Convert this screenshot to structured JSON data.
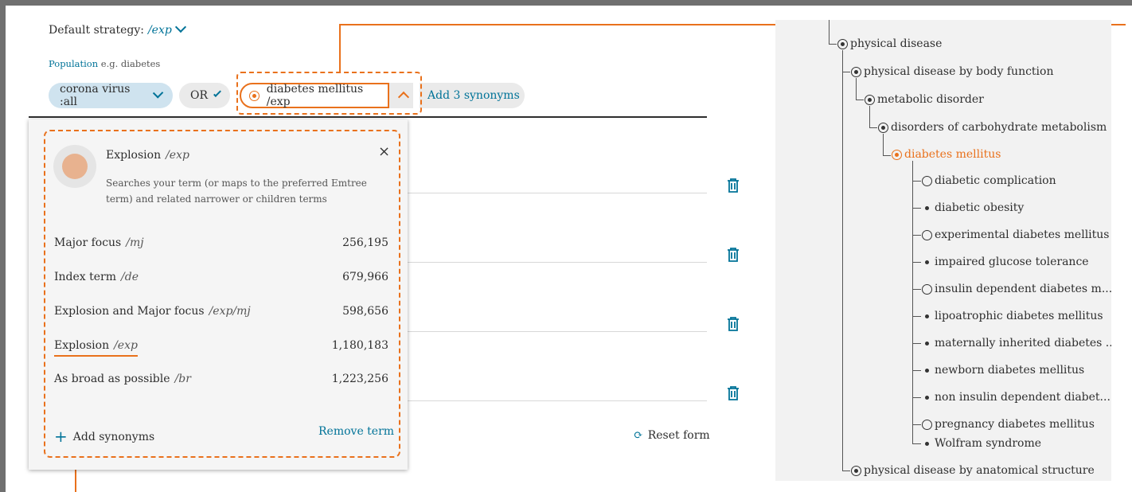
{
  "search": {
    "strategy_label": "Default strategy:",
    "strategy_value": "/exp",
    "population_label": "Population",
    "population_hint": "e.g. diabetes",
    "chip1": "corona virus :all",
    "operator": "OR",
    "active_term": "diabetes mellitus /exp",
    "add_synonyms": "Add 3 synonyms",
    "reset": "Reset form"
  },
  "popup": {
    "title": "Explosion",
    "title_code": "/exp",
    "description": "Searches your term (or maps to the preferred Emtree term) and related narrower or children terms",
    "close": "×",
    "options": [
      {
        "label": "Major focus",
        "code": "/mj",
        "count": "256,195"
      },
      {
        "label": "Index term",
        "code": "/de",
        "count": "679,966"
      },
      {
        "label": "Explosion and Major focus",
        "code": "/exp/mj",
        "count": "598,656"
      },
      {
        "label": "Explosion",
        "code": "/exp",
        "count": "1,180,183"
      },
      {
        "label": "As broad as possible",
        "code": "/br",
        "count": "1,223,256"
      }
    ],
    "add_synonyms": "Add synonyms",
    "remove_term": "Remove term"
  },
  "tree": {
    "nodes": [
      {
        "label": "physical disease",
        "marker": "filled"
      },
      {
        "label": "physical disease by body function",
        "marker": "filled"
      },
      {
        "label": "metabolic disorder",
        "marker": "filled"
      },
      {
        "label": "disorders of carbohydrate metabolism",
        "marker": "filled"
      },
      {
        "label": "diabetes mellitus",
        "marker": "filled",
        "highlight": true
      },
      {
        "label": "diabetic complication",
        "marker": "empty"
      },
      {
        "label": "diabetic obesity",
        "marker": "dot"
      },
      {
        "label": "experimental diabetes mellitus",
        "marker": "empty"
      },
      {
        "label": "impaired glucose tolerance",
        "marker": "dot"
      },
      {
        "label": "insulin dependent diabetes m...",
        "marker": "empty"
      },
      {
        "label": "lipoatrophic diabetes mellitus",
        "marker": "dot"
      },
      {
        "label": "maternally inherited diabetes ...",
        "marker": "dot"
      },
      {
        "label": "newborn diabetes mellitus",
        "marker": "dot"
      },
      {
        "label": "non insulin dependent diabet...",
        "marker": "dot"
      },
      {
        "label": "pregnancy diabetes mellitus",
        "marker": "empty"
      },
      {
        "label": "Wolfram syndrome",
        "marker": "dot"
      },
      {
        "label": "physical disease by anatomical structure",
        "marker": "filled"
      }
    ]
  },
  "colors": {
    "accent": "#e9711c",
    "link": "#007398",
    "chip": "#cfe3ef"
  }
}
